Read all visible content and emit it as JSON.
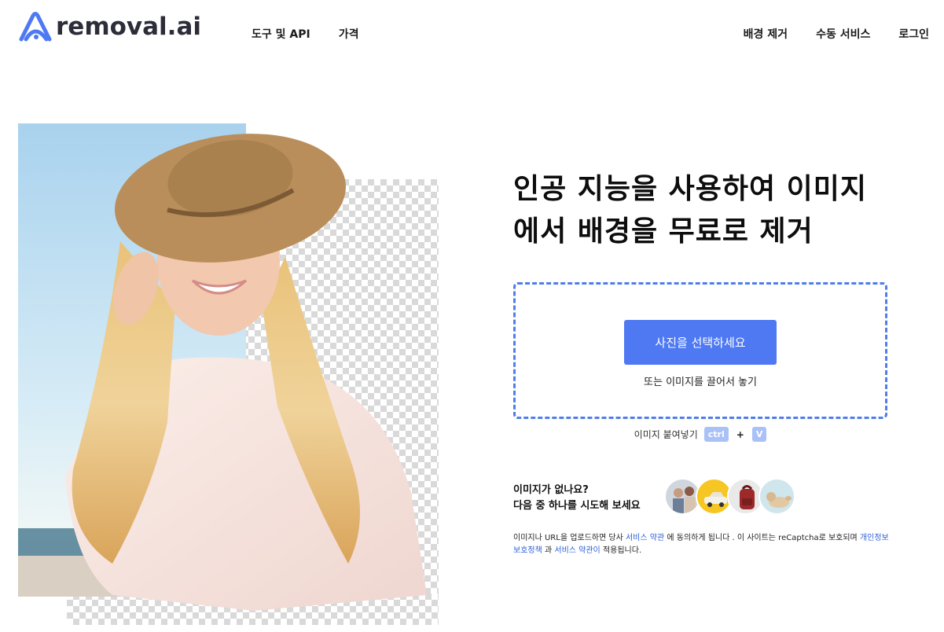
{
  "header": {
    "logo_text": "removal.ai",
    "nav_left": [
      "도구 및 API",
      "가격"
    ],
    "nav_right": [
      "배경 제거",
      "수동 서비스",
      "로그인"
    ]
  },
  "hero": {
    "title": "인공 지능을 사용하여 이미지에서 배경을 무료로 제거",
    "upload_button": "사진을 선택하세요",
    "drop_hint": "또는 이미지를 끌어서 놓기",
    "paste_label": "이미지 붙여넣기",
    "paste_key1": "ctrl",
    "paste_plus": "+",
    "paste_key2": "V"
  },
  "samples": {
    "line1": "이미지가 없나요?",
    "line2": "다음 중 하나를 시도해 보세요",
    "items": [
      "family-photo-icon",
      "car-photo-icon",
      "backpack-photo-icon",
      "dog-photo-icon"
    ]
  },
  "legal": {
    "t1": "이미지나 URL을 업로드하면 당사 ",
    "link1": "서비스 약관",
    "t2": " 에 동의하게 됩니다 . 이 사이트는 reCaptcha로 보호되며 ",
    "link2": "개인정보 보호정책",
    "t3": " 과 ",
    "link3": "서비스 약관이",
    "t4": " 적용됩니다."
  },
  "colors": {
    "accent": "#4e79f3",
    "dash": "#4f7ee8",
    "key_bg": "#a9c1f7",
    "link": "#2e60d8"
  }
}
